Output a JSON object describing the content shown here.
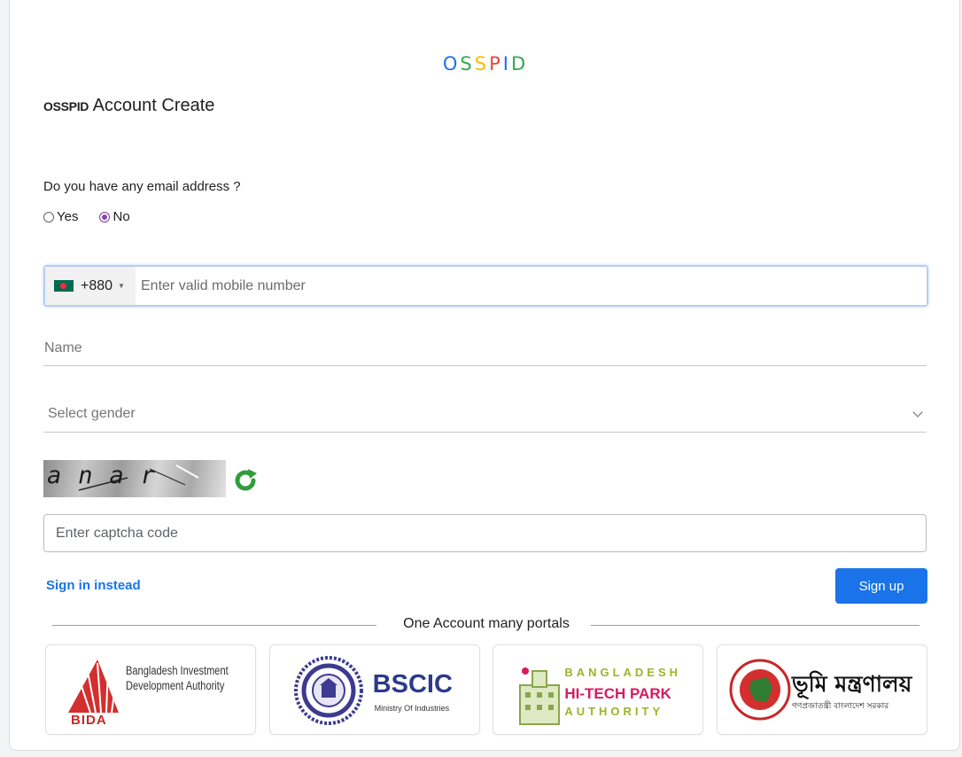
{
  "brand": {
    "logo_letters": [
      {
        "char": "O",
        "color": "#1a73e8"
      },
      {
        "char": "S",
        "color": "#34a853"
      },
      {
        "char": "S",
        "color": "#fbbc05"
      },
      {
        "char": "P",
        "color": "#ea4335"
      },
      {
        "char": "I",
        "color": "#1a73e8"
      },
      {
        "char": "D",
        "color": "#34a853"
      }
    ],
    "heading_brand": "OSSPID",
    "heading_text": " Account Create"
  },
  "form": {
    "email_question": "Do you have any email address ?",
    "radio_options": [
      {
        "label": "Yes",
        "checked": false
      },
      {
        "label": "No",
        "checked": true
      }
    ],
    "phone": {
      "country_code": "+880",
      "flag_icon": "bangladesh-flag-icon",
      "placeholder": "Enter valid mobile number",
      "value": ""
    },
    "name": {
      "placeholder": "Name",
      "value": ""
    },
    "gender": {
      "placeholder": "Select gender"
    },
    "captcha": {
      "image_text": "anar",
      "refresh_icon": "refresh-icon",
      "placeholder": "Enter captcha code",
      "value": ""
    }
  },
  "actions": {
    "sign_in_label": "Sign in instead",
    "sign_up_label": "Sign up"
  },
  "portals": {
    "divider_label": "One Account many portals",
    "items": [
      {
        "id": "bida",
        "line1": "Bangladesh Investment",
        "line2": "Development Authority",
        "abbr": "BIDA"
      },
      {
        "id": "bscic",
        "title": "BSCIC",
        "subtitle": "Ministry Of Industries"
      },
      {
        "id": "htpa",
        "line1": "BANGLADESH",
        "line2": "HI-TECH PARK",
        "line3": "AUTHORITY"
      },
      {
        "id": "bhumi",
        "title": "ভূমি মন্ত্রণালয়",
        "subtitle": "গণপ্রজাতন্ত্রী বাংলাদেশ সরকার"
      }
    ]
  },
  "colors": {
    "primary": "#1a73e8",
    "radio_checked": "#8e44ad",
    "refresh_green": "#2e9e3a"
  }
}
